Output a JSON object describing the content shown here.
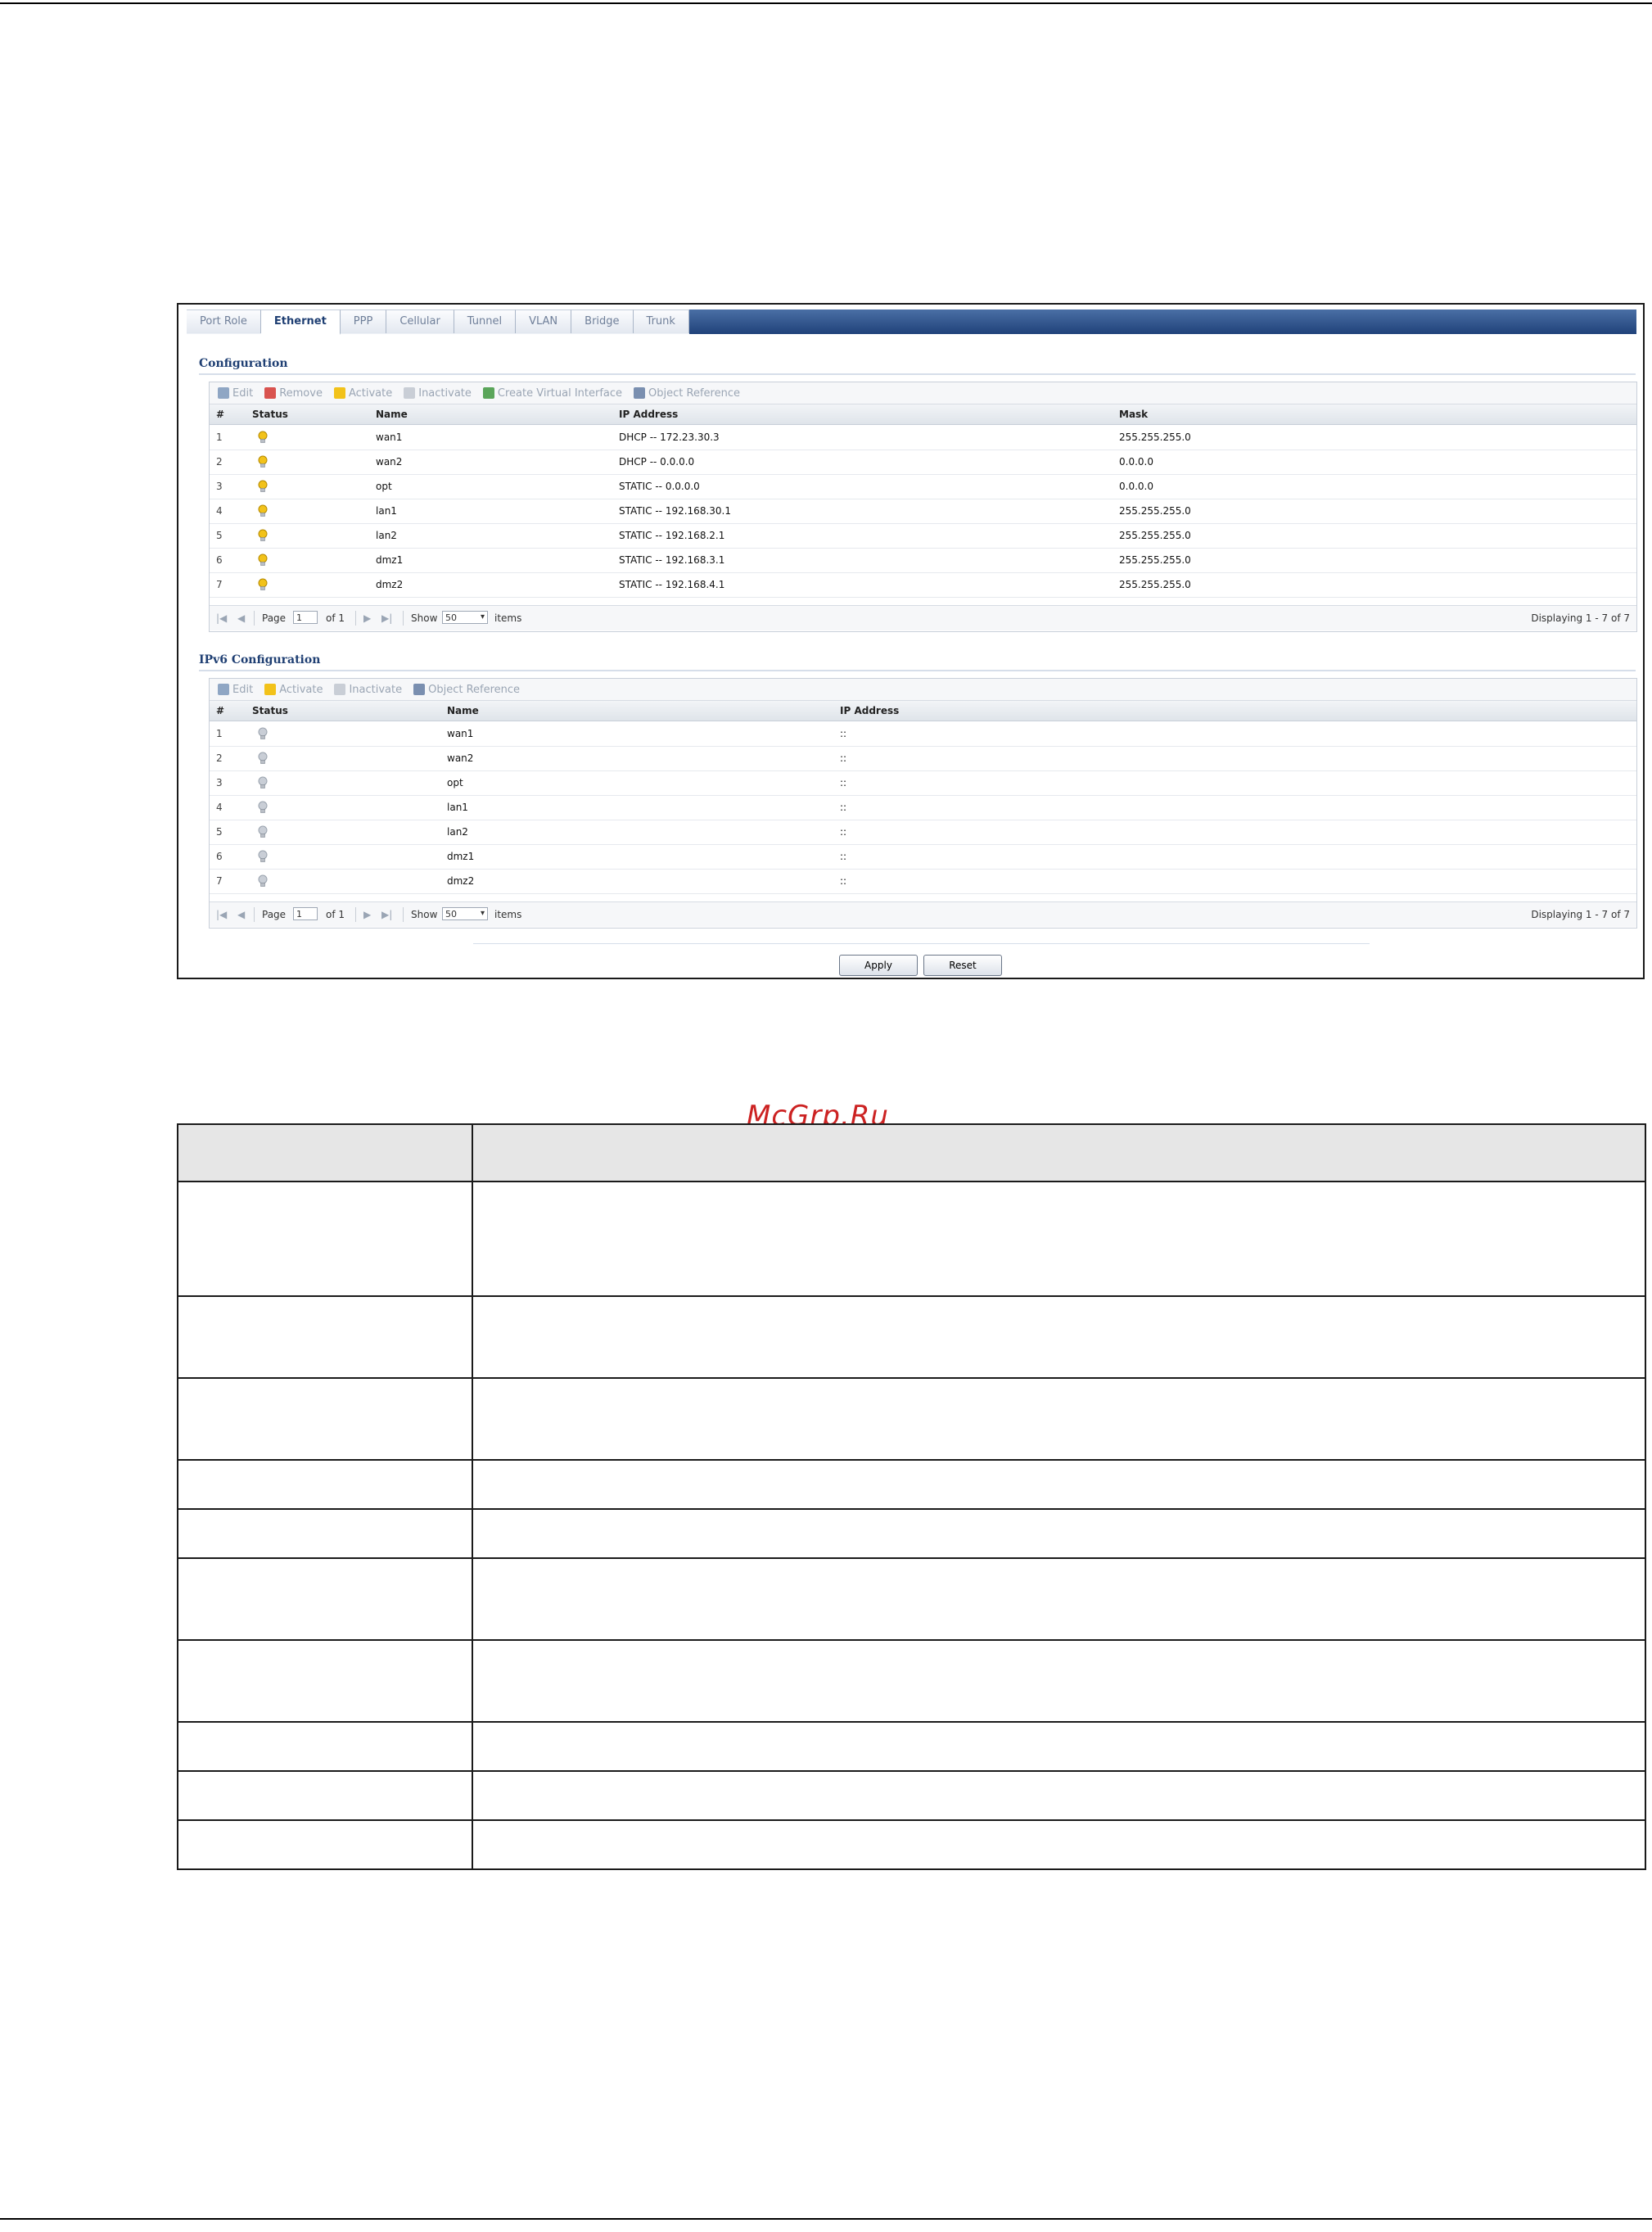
{
  "watermark": "McGrp.Ru",
  "tabs": [
    "Port Role",
    "Ethernet",
    "PPP",
    "Cellular",
    "Tunnel",
    "VLAN",
    "Bridge",
    "Trunk"
  ],
  "config": {
    "title": "Configuration",
    "toolbar": [
      "Edit",
      "Remove",
      "Activate",
      "Inactivate",
      "Create Virtual Interface",
      "Object Reference"
    ],
    "columns": [
      "#",
      "Status",
      "Name",
      "IP Address",
      "Mask"
    ],
    "rows": [
      {
        "num": "1",
        "name": "wan1",
        "ip": "DHCP -- 172.23.30.3",
        "mask": "255.255.255.0"
      },
      {
        "num": "2",
        "name": "wan2",
        "ip": "DHCP -- 0.0.0.0",
        "mask": "0.0.0.0"
      },
      {
        "num": "3",
        "name": "opt",
        "ip": "STATIC -- 0.0.0.0",
        "mask": "0.0.0.0"
      },
      {
        "num": "4",
        "name": "lan1",
        "ip": "STATIC -- 192.168.30.1",
        "mask": "255.255.255.0"
      },
      {
        "num": "5",
        "name": "lan2",
        "ip": "STATIC -- 192.168.2.1",
        "mask": "255.255.255.0"
      },
      {
        "num": "6",
        "name": "dmz1",
        "ip": "STATIC -- 192.168.3.1",
        "mask": "255.255.255.0"
      },
      {
        "num": "7",
        "name": "dmz2",
        "ip": "STATIC -- 192.168.4.1",
        "mask": "255.255.255.0"
      }
    ],
    "pager": {
      "page_label": "Page",
      "page_value": "1",
      "of_label": "of 1",
      "show_label": "Show",
      "show_value": "50",
      "items_label": "items",
      "displaying": "Displaying 1 - 7 of 7"
    }
  },
  "ipv6": {
    "title": "IPv6 Configuration",
    "toolbar": [
      "Edit",
      "Activate",
      "Inactivate",
      "Object Reference"
    ],
    "columns": [
      "#",
      "Status",
      "Name",
      "IP Address"
    ],
    "rows": [
      {
        "num": "1",
        "name": "wan1",
        "ip": "::"
      },
      {
        "num": "2",
        "name": "wan2",
        "ip": "::"
      },
      {
        "num": "3",
        "name": "opt",
        "ip": "::"
      },
      {
        "num": "4",
        "name": "lan1",
        "ip": "::"
      },
      {
        "num": "5",
        "name": "lan2",
        "ip": "::"
      },
      {
        "num": "6",
        "name": "dmz1",
        "ip": "::"
      },
      {
        "num": "7",
        "name": "dmz2",
        "ip": "::"
      }
    ],
    "pager": {
      "page_label": "Page",
      "page_value": "1",
      "of_label": "of 1",
      "show_label": "Show",
      "show_value": "50",
      "items_label": "items",
      "displaying": "Displaying 1 - 7 of 7"
    }
  },
  "buttons": {
    "apply": "Apply",
    "reset": "Reset"
  },
  "colors": {
    "tab_active": "#1f3f73",
    "bulb_on": "#f2c21a",
    "bulb_off": "#c9ced6"
  }
}
